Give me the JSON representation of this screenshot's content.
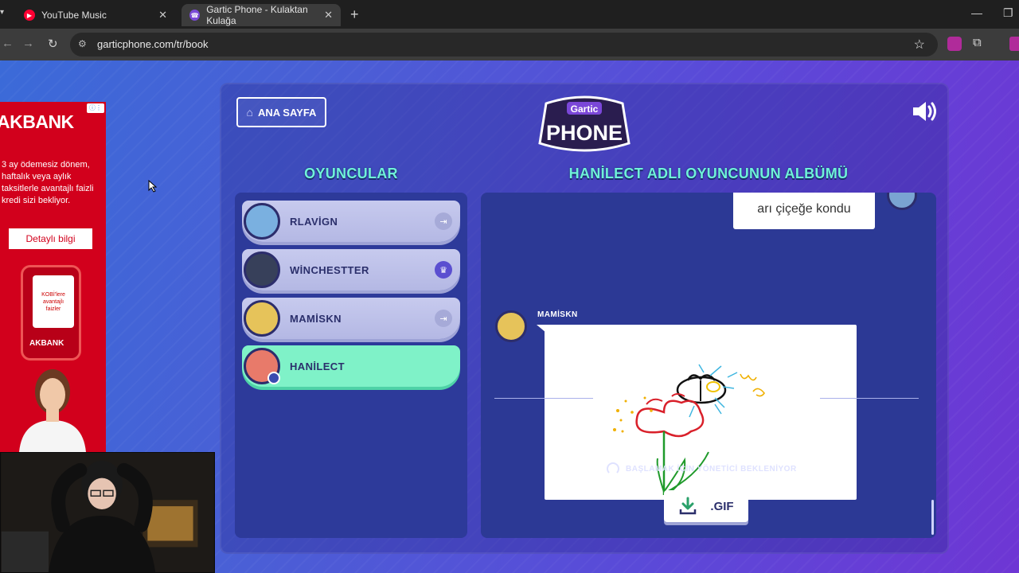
{
  "browser": {
    "tabs": [
      {
        "title": "YouTube Music",
        "active": false,
        "favicon": "youtube-music-icon",
        "color": "#ff0033"
      },
      {
        "title": "Gartic Phone - Kulaktan Kulağa",
        "active": true,
        "favicon": "phone-icon",
        "color": "#7a4bd6"
      }
    ],
    "url": "garticphone.com/tr/book"
  },
  "ad": {
    "brand": "AKBANK",
    "text": "3 ay ödemesiz dönem, haftalık veya aylık taksitlerle avantajlı faizli kredi sizi bekliyor.",
    "cta": "Detaylı bilgi",
    "phone_text": "KOBİ'lere avantajlı faizler",
    "phone_brand": "AKBANK"
  },
  "game": {
    "home_button": "ANA SAYFA",
    "logo_top": "Gartic",
    "logo_bottom": "PHONE",
    "players_title": "OYUNCULAR",
    "album_title": "HANİLECT ADLI OYUNCUNUN ALBÜMÜ",
    "players": [
      {
        "name": "RLAVİGN",
        "badge": "exit-icon",
        "active": false,
        "avatar_color": "#7ab0e0"
      },
      {
        "name": "WİNCHESTTER",
        "badge": "crown-icon",
        "active": false,
        "avatar_color": "#37405a"
      },
      {
        "name": "MAMİSKN",
        "badge": "exit-icon",
        "active": false,
        "avatar_color": "#e6c35a"
      },
      {
        "name": "HANİLECT",
        "badge": "",
        "active": true,
        "avatar_color": "#e87a6a"
      }
    ],
    "album": {
      "prev_text": "arı çiçeğe kondu",
      "author": "MAMİSKN"
    },
    "waiting_text": "BAŞLAMAK İÇİN YÖNETİCİ BEKLENİYOR",
    "gif_button": ".GIF"
  },
  "colors": {
    "accent_teal": "#6ff2d9",
    "active_row": "#7ff2c8",
    "bank_red": "#d2001c"
  }
}
